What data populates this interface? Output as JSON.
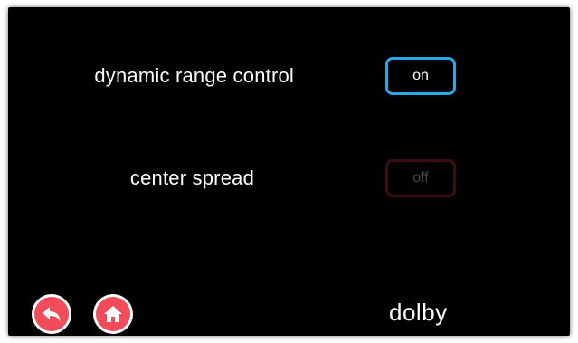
{
  "settings": [
    {
      "label": "dynamic range control",
      "state": "on"
    },
    {
      "label": "center spread",
      "state": "off"
    }
  ],
  "navigation": {
    "back_icon": "back-arrow-icon",
    "home_icon": "home-icon"
  },
  "brand": "dolby",
  "colors": {
    "screen_bg": "#000000",
    "on_border": "#2aa8e6",
    "off_border": "#3a0e12",
    "nav_button_fill": "#f24b5a"
  }
}
